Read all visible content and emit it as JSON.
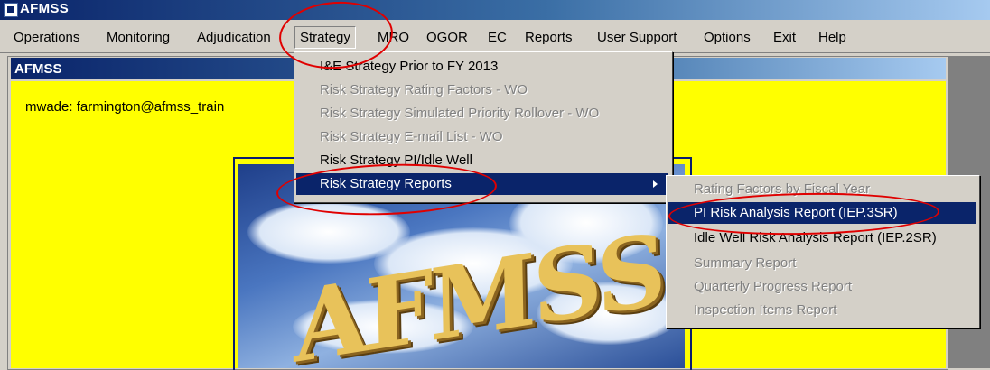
{
  "window": {
    "title": "AFMSS"
  },
  "menubar": {
    "items": [
      {
        "label": "Operations"
      },
      {
        "label": "Monitoring"
      },
      {
        "label": "Adjudication"
      },
      {
        "label": "Strategy"
      },
      {
        "label": "MRO"
      },
      {
        "label": "OGOR"
      },
      {
        "label": "EC"
      },
      {
        "label": "Reports"
      },
      {
        "label": "User Support"
      },
      {
        "label": "Options"
      },
      {
        "label": "Exit"
      },
      {
        "label": "Help"
      }
    ]
  },
  "child_window": {
    "title": "AFMSS",
    "user_label": "mwade: farmington@afmss_train",
    "splash_text": "AFMSS"
  },
  "strategy_menu": {
    "items": [
      {
        "label": "I&E Strategy Prior to FY 2013",
        "state": "enabled"
      },
      {
        "label": "Risk Strategy Rating Factors - WO",
        "state": "disabled"
      },
      {
        "label": "Risk Strategy Simulated Priority Rollover - WO",
        "state": "disabled"
      },
      {
        "label": "Risk Strategy E-mail List - WO",
        "state": "disabled"
      },
      {
        "label": "Risk Strategy PI/Idle Well",
        "state": "enabled"
      },
      {
        "label": "Risk Strategy Reports",
        "state": "selected"
      }
    ]
  },
  "reports_submenu": {
    "items": [
      {
        "label": "Rating Factors by Fiscal Year",
        "state": "disabled"
      },
      {
        "label": "PI Risk Analysis Report (IEP.3SR)",
        "state": "selected"
      },
      {
        "label": "Idle Well Risk Analysis Report (IEP.2SR)",
        "state": "enabled"
      },
      {
        "label": "Summary Report",
        "state": "disabled"
      },
      {
        "label": "Quarterly Progress Report",
        "state": "disabled"
      },
      {
        "label": "Inspection Items Report",
        "state": "disabled"
      }
    ]
  },
  "colors": {
    "highlight": "#0a246a",
    "client_background": "#ffff00",
    "annotation_ring": "#e00000"
  }
}
